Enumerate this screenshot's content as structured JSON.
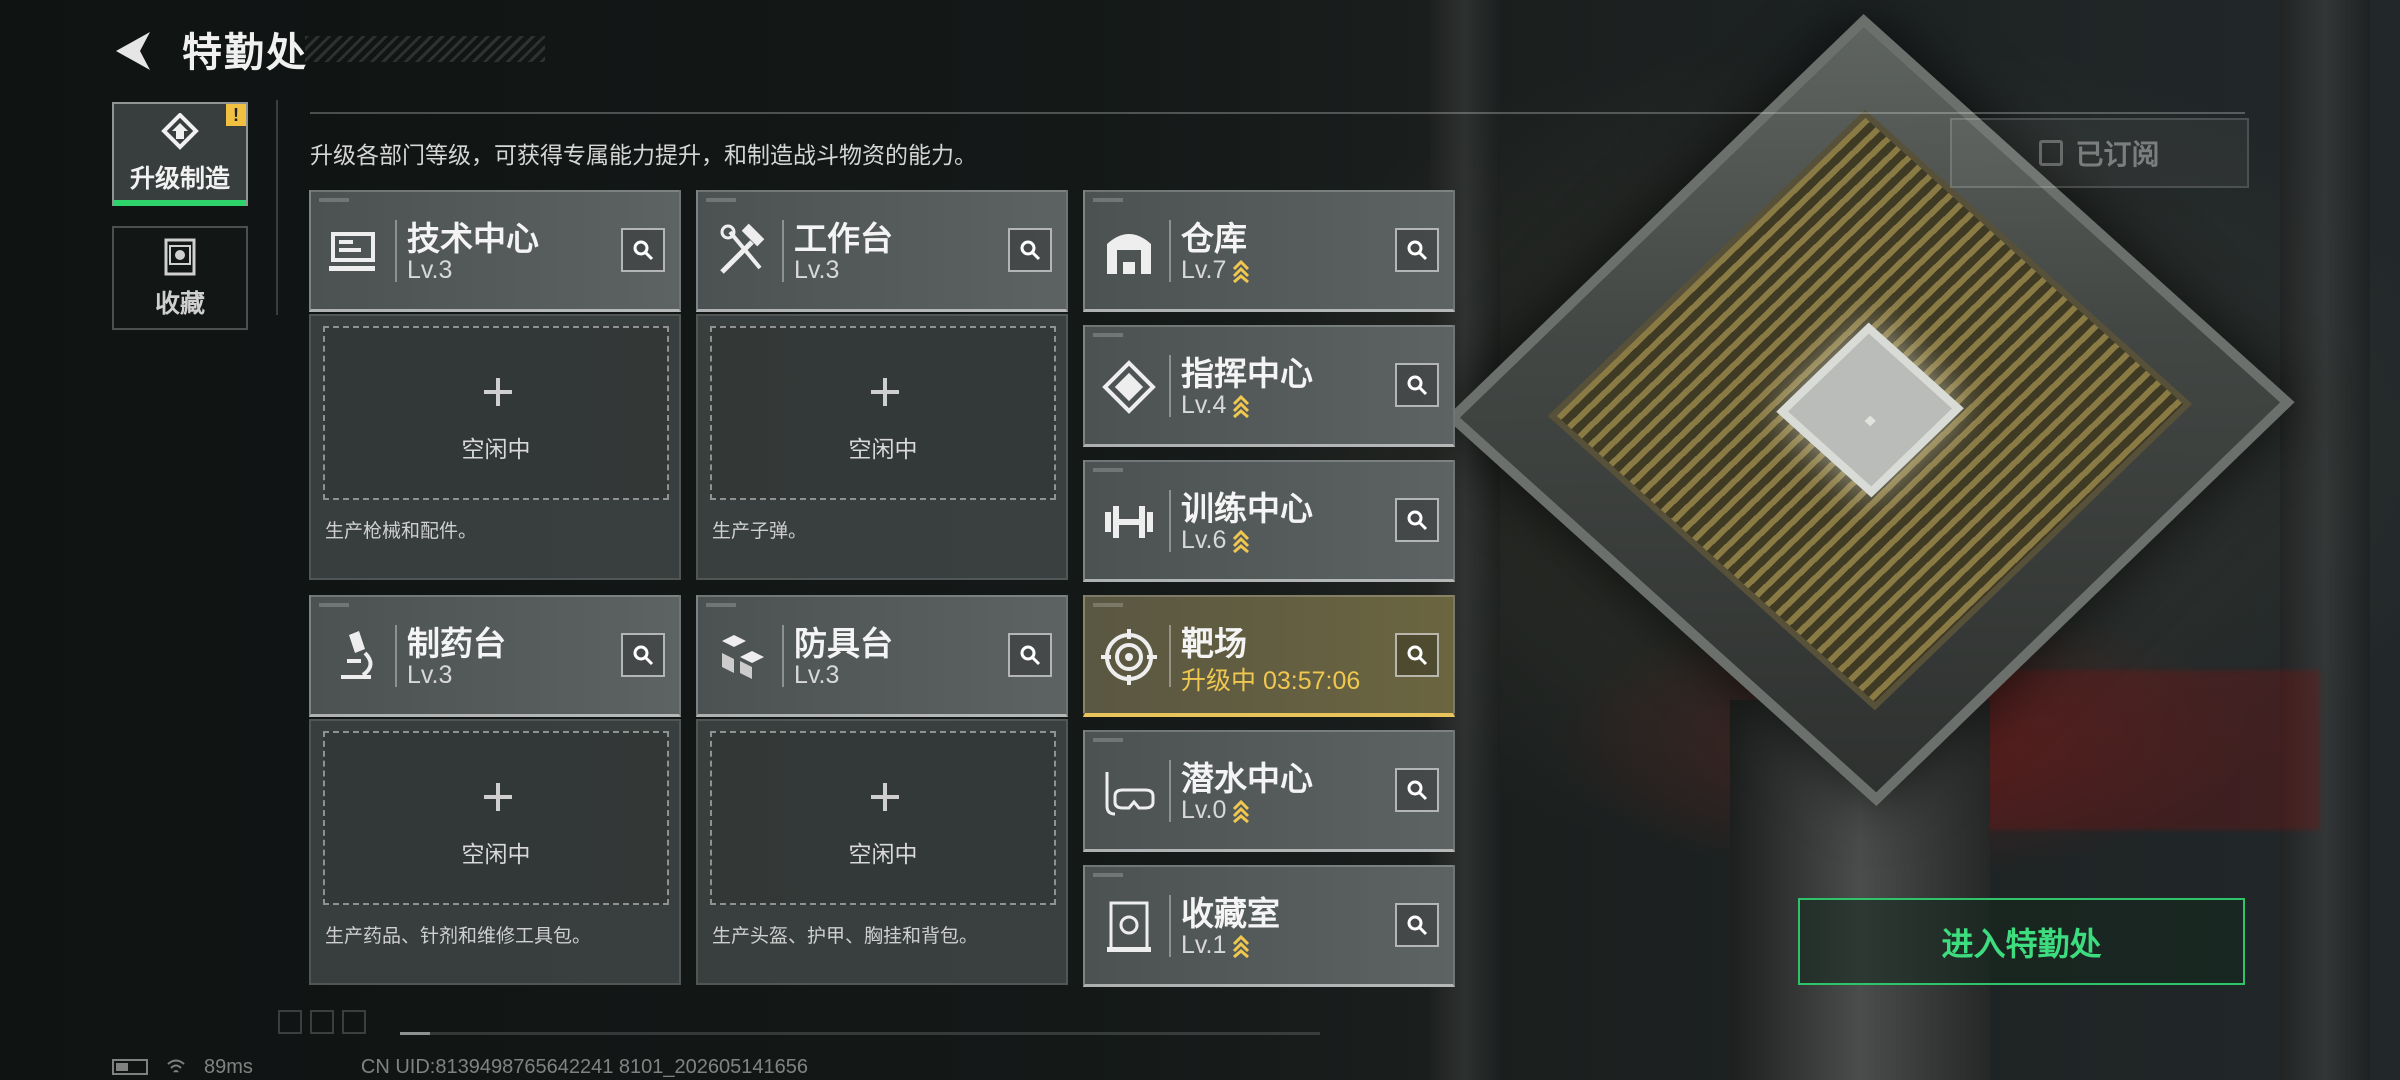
{
  "header": {
    "title": "特勤处"
  },
  "description": "升级各部门等级，可获得专属能力提升，和制造战斗物资的能力。",
  "subscribe_label": "已订阅",
  "tabs": [
    {
      "label": "升级制造",
      "badge": "!"
    },
    {
      "label": "收藏"
    }
  ],
  "departments": {
    "tech": {
      "name": "技术中心",
      "level": "Lv.3",
      "slot_status": "空闲中",
      "slot_desc": "生产枪械和配件。"
    },
    "workbench": {
      "name": "工作台",
      "level": "Lv.3",
      "slot_status": "空闲中",
      "slot_desc": "生产子弹。"
    },
    "pharmacy": {
      "name": "制药台",
      "level": "Lv.3",
      "slot_status": "空闲中",
      "slot_desc": "生产药品、针剂和维修工具包。"
    },
    "armor": {
      "name": "防具台",
      "level": "Lv.3",
      "slot_status": "空闲中",
      "slot_desc": "生产头盔、护甲、胸挂和背包。"
    },
    "warehouse": {
      "name": "仓库",
      "level": "Lv.7"
    },
    "command": {
      "name": "指挥中心",
      "level": "Lv.4"
    },
    "training": {
      "name": "训练中心",
      "level": "Lv.6"
    },
    "range": {
      "name": "靶场",
      "status": "升级中 03:57:06"
    },
    "diving": {
      "name": "潜水中心",
      "level": "Lv.0"
    },
    "collection": {
      "name": "收藏室",
      "level": "Lv.1"
    }
  },
  "enter_button": "进入特勤处",
  "status": {
    "ping": "89ms",
    "uid": "CN UID:8139498765642241 8101_202605141656"
  },
  "colors": {
    "accent_green": "#2fd36c",
    "upgrade_gold": "#f0c850"
  }
}
